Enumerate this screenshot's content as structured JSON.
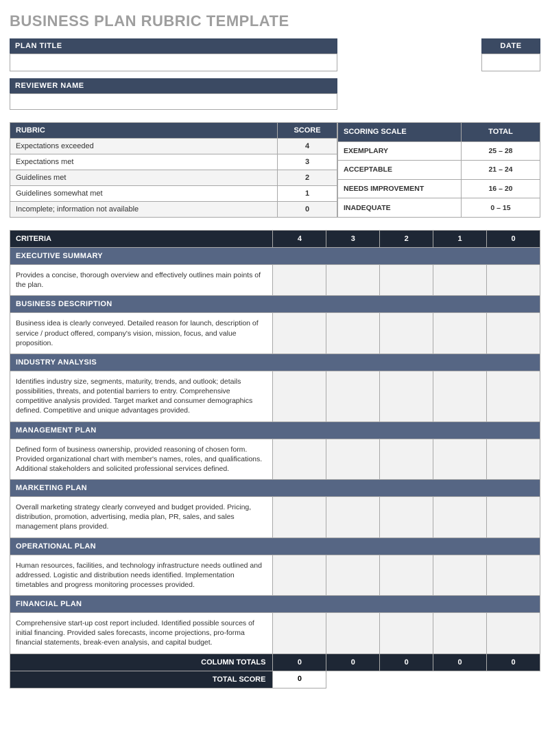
{
  "title": "BUSINESS PLAN RUBRIC TEMPLATE",
  "header": {
    "plan_title_label": "PLAN TITLE",
    "date_label": "DATE",
    "reviewer_label": "REVIEWER NAME"
  },
  "rubric": {
    "header_label": "RUBRIC",
    "score_label": "SCORE",
    "rows": [
      {
        "label": "Expectations exceeded",
        "score": "4"
      },
      {
        "label": "Expectations met",
        "score": "3"
      },
      {
        "label": "Guidelines met",
        "score": "2"
      },
      {
        "label": "Guidelines somewhat met",
        "score": "1"
      },
      {
        "label": "Incomplete; information not available",
        "score": "0"
      }
    ]
  },
  "scale": {
    "header_label": "SCORING SCALE",
    "total_label": "TOTAL",
    "rows": [
      {
        "label": "EXEMPLARY",
        "range": "25 – 28"
      },
      {
        "label": "ACCEPTABLE",
        "range": "21 – 24"
      },
      {
        "label": "NEEDS IMPROVEMENT",
        "range": "16 – 20"
      },
      {
        "label": "INADEQUATE",
        "range": "0 – 15"
      }
    ]
  },
  "criteria": {
    "header": "CRITERIA",
    "cols": [
      "4",
      "3",
      "2",
      "1",
      "0"
    ],
    "sections": [
      {
        "title": "EXECUTIVE SUMMARY",
        "desc": "Provides a concise, thorough overview and effectively outlines main points of the plan."
      },
      {
        "title": "BUSINESS DESCRIPTION",
        "desc": "Business idea is clearly conveyed. Detailed reason for launch, description of service / product offered, company's vision, mission, focus, and value proposition."
      },
      {
        "title": "INDUSTRY ANALYSIS",
        "desc": "Identifies industry size, segments, maturity, trends, and outlook; details possibilities, threats, and potential barriers to entry. Comprehensive competitive analysis provided. Target market and consumer demographics defined. Competitive and unique advantages provided."
      },
      {
        "title": "MANAGEMENT PLAN",
        "desc": "Defined form of business ownership, provided reasoning of chosen form. Provided organizational chart with member's names, roles, and qualifications.  Additional stakeholders and solicited professional services defined."
      },
      {
        "title": "MARKETING PLAN",
        "desc": "Overall marketing strategy clearly conveyed and budget provided. Pricing, distribution, promotion, advertising, media plan, PR, sales, and sales management plans provided."
      },
      {
        "title": "OPERATIONAL PLAN",
        "desc": "Human resources, facilities, and technology infrastructure needs outlined and addressed. Logistic and distribution needs identified.  Implementation timetables and progress monitoring processes provided."
      },
      {
        "title": "FINANCIAL PLAN",
        "desc": "Comprehensive start-up cost report included. Identified possible sources of initial financing.  Provided sales forecasts, income projections, pro-forma financial statements, break-even analysis, and capital budget."
      }
    ],
    "column_totals_label": "COLUMN TOTALS",
    "column_totals": [
      "0",
      "0",
      "0",
      "0",
      "0"
    ],
    "total_score_label": "TOTAL SCORE",
    "total_score": "0"
  }
}
